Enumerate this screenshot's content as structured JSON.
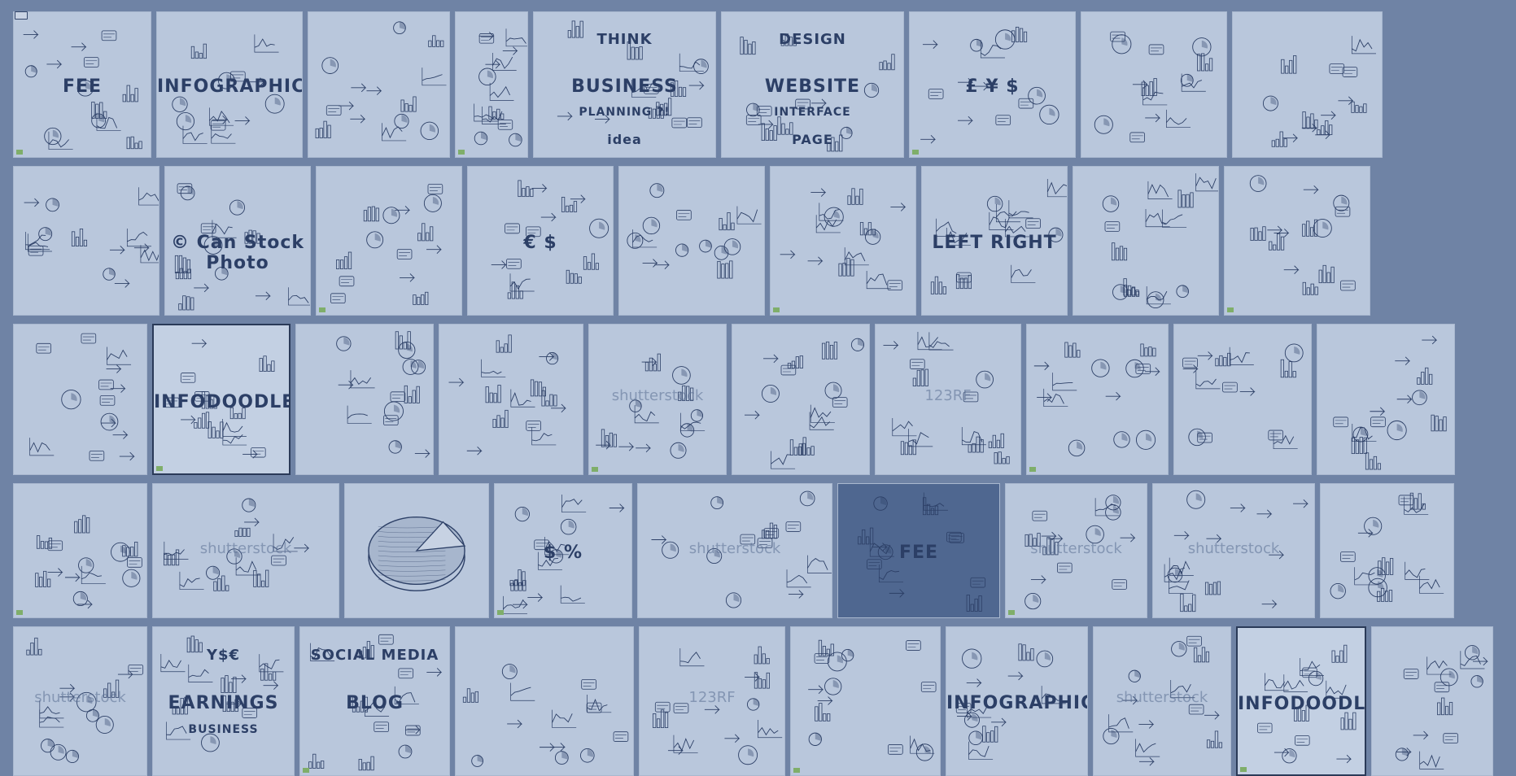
{
  "theme": {
    "background": "#6f83a5",
    "tile": "#b9c7dc",
    "ink": "#2c3f66",
    "highlight_tile": "#4f6790"
  },
  "rows": [
    {
      "items": [
        {
          "icon": "business-doodles",
          "text": "FEE"
        },
        {
          "icon": "infographic-doodles",
          "text": "INFOGRAPHIC"
        },
        {
          "icon": "chart-doodles",
          "text": ""
        },
        {
          "icon": "network-doodles",
          "text": ""
        },
        {
          "icon": "business-planning-doodles",
          "text": "BUSINESS",
          "text2": "THINK",
          "text3": "PLANNING ?!",
          "text4": "idea"
        },
        {
          "icon": "website-design-doodles",
          "text": "WEBSITE",
          "text2": "DESIGN",
          "text3": "INTERFACE",
          "text4": "PAGE"
        },
        {
          "icon": "finance-doodles",
          "text": "£ ¥ $"
        },
        {
          "icon": "social-doodles",
          "text": ""
        },
        {
          "icon": "network-doodles",
          "text": ""
        }
      ]
    },
    {
      "items": [
        {
          "icon": "business-doodles",
          "text": ""
        },
        {
          "icon": "chart-doodles",
          "text": "© Can Stock Photo"
        },
        {
          "icon": "infographic-doodles",
          "text": ""
        },
        {
          "icon": "finance-doodles",
          "text": "€ $"
        },
        {
          "icon": "chart-doodles",
          "text": ""
        },
        {
          "icon": "chart-doodles",
          "text": ""
        },
        {
          "icon": "idea-doodles",
          "text": "LEFT  RIGHT"
        },
        {
          "icon": "presenter-doodles",
          "text": ""
        },
        {
          "icon": "science-doodles",
          "text": ""
        }
      ]
    },
    {
      "items": [
        {
          "icon": "pie-doodles",
          "text": ""
        },
        {
          "icon": "infodoodles",
          "text": "INFODOODLES"
        },
        {
          "icon": "3d-chart-doodles",
          "text": ""
        },
        {
          "icon": "circle-doodles",
          "text": ""
        },
        {
          "icon": "circle-doodles",
          "text": "",
          "watermark": "shutterstock"
        },
        {
          "icon": "chart-doodles",
          "text": ""
        },
        {
          "icon": "circle-doodles",
          "text": "",
          "watermark": "123RF"
        },
        {
          "icon": "chart-doodles",
          "text": ""
        },
        {
          "icon": "circle-doodles",
          "text": ""
        },
        {
          "icon": "timeline-doodles",
          "text": ""
        }
      ]
    },
    {
      "items": [
        {
          "icon": "chart-doodles",
          "text": ""
        },
        {
          "icon": "network-doodles",
          "text": "",
          "watermark": "shutterstock"
        },
        {
          "icon": "big-pie-doodle",
          "text": ""
        },
        {
          "icon": "finance-doodles",
          "text": "$ %"
        },
        {
          "icon": "business-doodles",
          "text": "",
          "watermark": "shutterstock"
        },
        {
          "icon": "business-doodles-dark",
          "text": "FEE"
        },
        {
          "icon": "circle-doodles",
          "text": "",
          "watermark": "shutterstock"
        },
        {
          "icon": "cloud-doodles",
          "text": "",
          "watermark": "shutterstock"
        },
        {
          "icon": "icon-doodles",
          "text": ""
        }
      ]
    },
    {
      "items": [
        {
          "icon": "handwriting-doodles",
          "text": "",
          "watermark": "shutterstock"
        },
        {
          "icon": "earnings-doodles",
          "text": "EARNINGS",
          "text2": "Y$€",
          "text3": "BUSINESS"
        },
        {
          "icon": "social-doodles",
          "text": "BLOG",
          "text2": "SOCIAL MEDIA"
        },
        {
          "icon": "chart-doodles",
          "text": ""
        },
        {
          "icon": "clock-doodles",
          "text": "",
          "watermark": "123RF"
        },
        {
          "icon": "handwriting-doodles",
          "text": ""
        },
        {
          "icon": "infographic-doodles-3d",
          "text": "INFOGRAPHIC"
        },
        {
          "icon": "chart-doodles",
          "text": "",
          "watermark": "shutterstock"
        },
        {
          "icon": "infodoodles",
          "text": "INFODOODLES"
        },
        {
          "icon": "world-doodles",
          "text": ""
        }
      ]
    }
  ]
}
